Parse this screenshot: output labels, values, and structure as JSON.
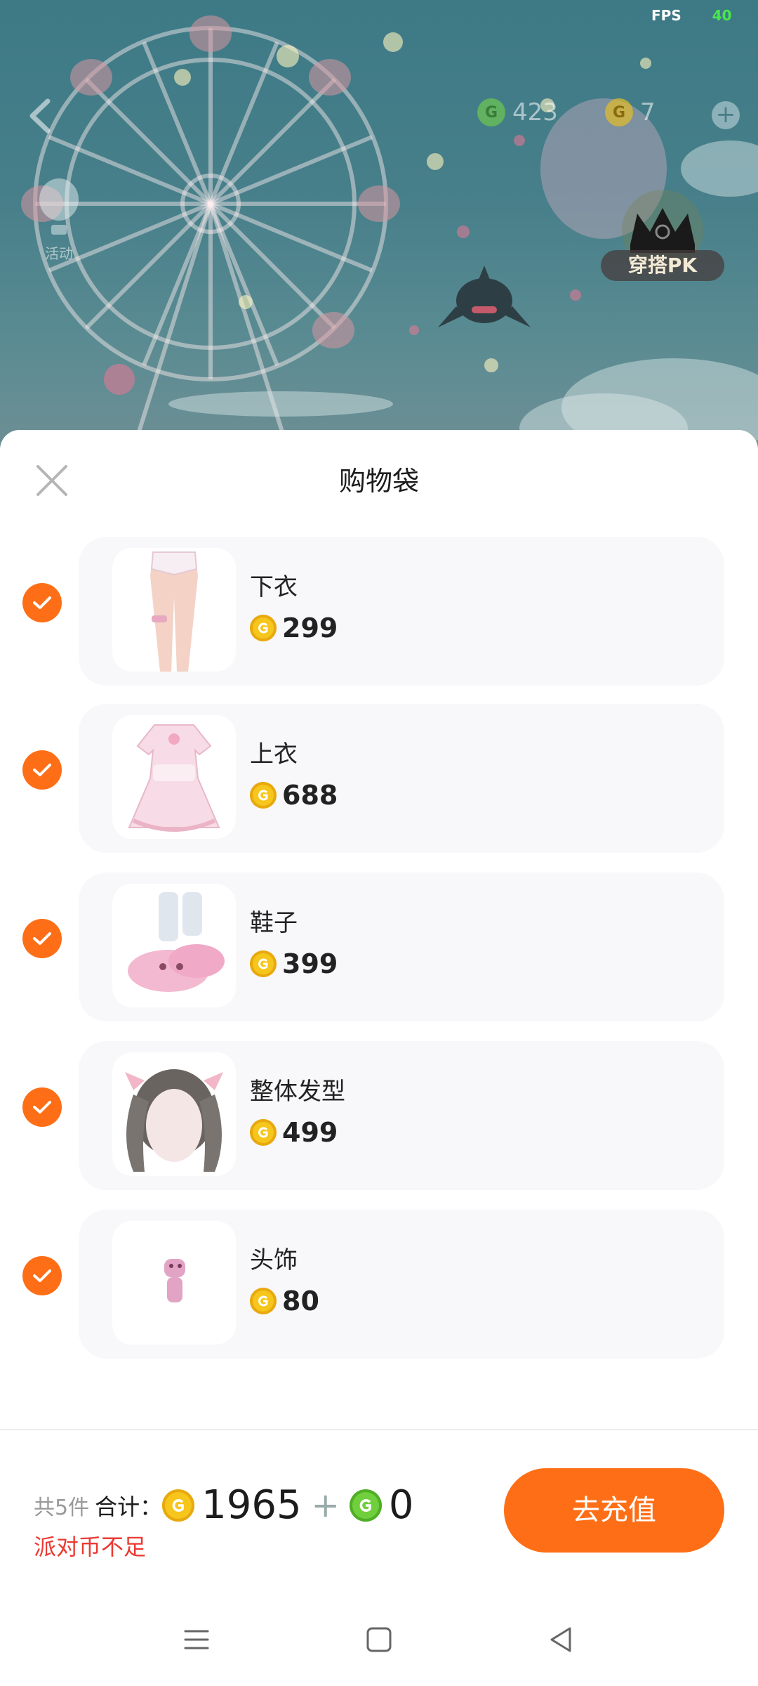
{
  "status": {
    "fps_label": "FPS",
    "fps_value": "40"
  },
  "hud": {
    "green_coins": "423",
    "gold_coins": "7",
    "event_label": "活动",
    "pk_label": "穿搭PK"
  },
  "sheet": {
    "title": "购物袋",
    "items": [
      {
        "name": "下衣",
        "price": "299"
      },
      {
        "name": "上衣",
        "price": "688"
      },
      {
        "name": "鞋子",
        "price": "399"
      },
      {
        "name": "整体发型",
        "price": "499"
      },
      {
        "name": "头饰",
        "price": "80"
      }
    ]
  },
  "summary": {
    "count_text": "共5件",
    "total_label": "合计：",
    "gold_total": "1965",
    "plus": "+",
    "green_total": "0",
    "warning": "派对币不足",
    "recharge_label": "去充值"
  },
  "colors": {
    "accent": "#fe6e16",
    "warning": "#ea3a32",
    "gold_coin": "#f6c61c",
    "green_coin": "#6fcf3c"
  }
}
